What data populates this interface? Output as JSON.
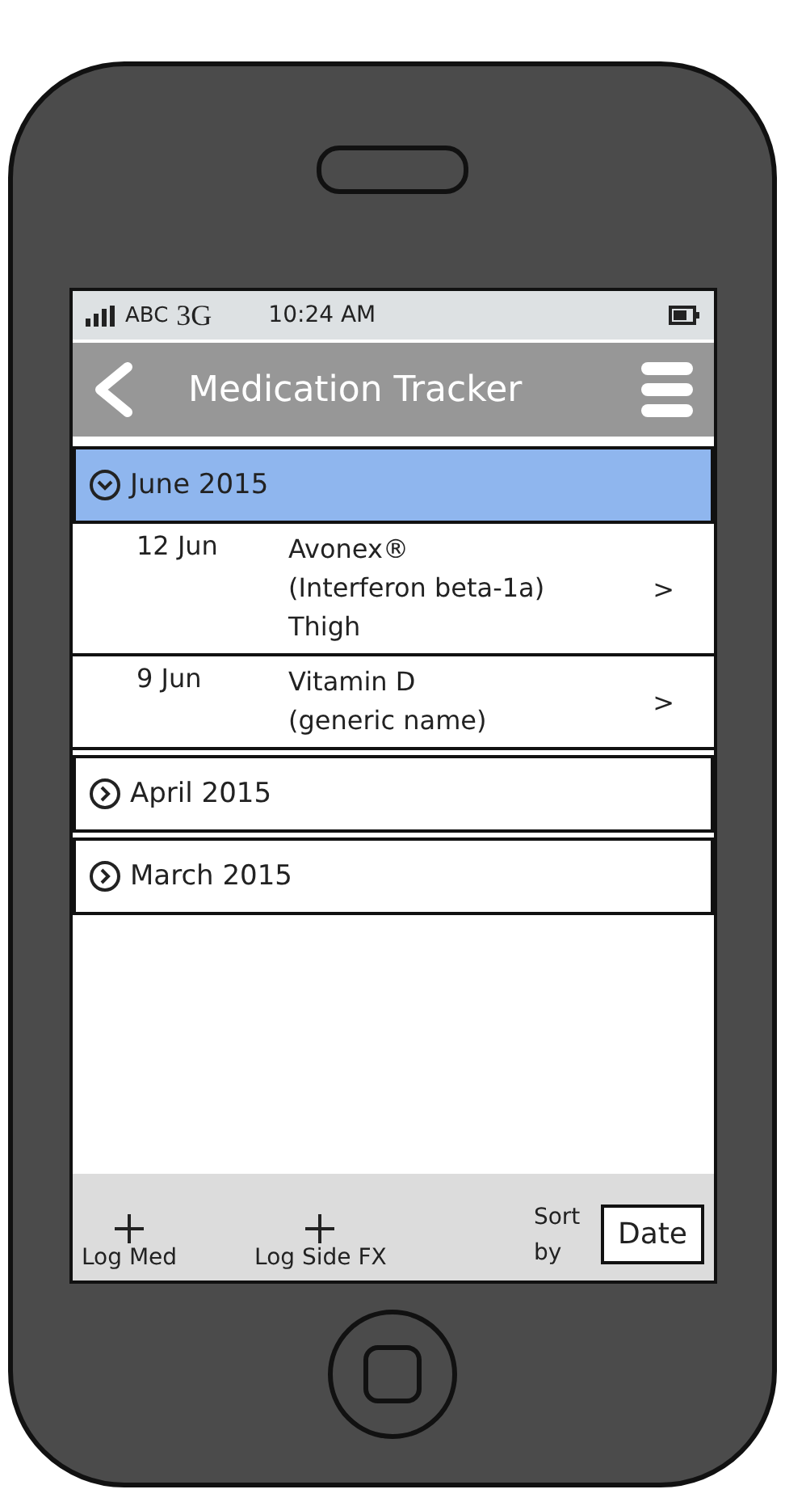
{
  "status_bar": {
    "carrier": "ABC",
    "network": "3G",
    "time": "10:24 AM"
  },
  "header": {
    "title": "Medication Tracker"
  },
  "sections": [
    {
      "label": "June 2015",
      "expanded": true,
      "selected": true,
      "items": [
        {
          "date": "12 Jun",
          "lines": [
            "Avonex®",
            "(Interferon beta-1a)",
            "Thigh"
          ],
          "chevron": ">"
        },
        {
          "date": "9 Jun",
          "lines": [
            "Vitamin D",
            "(generic name)"
          ],
          "chevron": ">"
        }
      ]
    },
    {
      "label": "April 2015",
      "expanded": false,
      "selected": false
    },
    {
      "label": "March 2015",
      "expanded": false,
      "selected": false
    }
  ],
  "toolbar": {
    "actions": [
      {
        "kind": "add",
        "label": "Log Med"
      },
      {
        "kind": "add",
        "label": "Log Side FX"
      }
    ],
    "sort_label": "Sort by",
    "sort_value": "Date"
  }
}
